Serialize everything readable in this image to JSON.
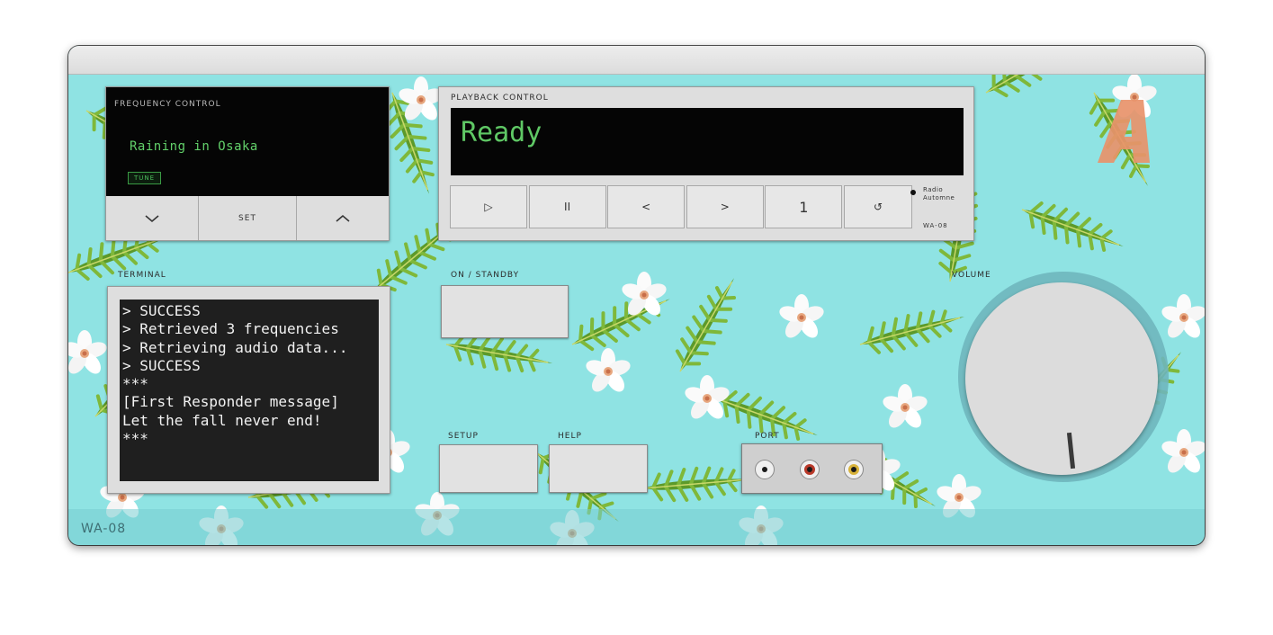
{
  "device": {
    "model_bottom": "WA-08",
    "logo_letter": "A"
  },
  "frequency_control": {
    "label": "FREQUENCY CONTROL",
    "station": "Raining in Osaka",
    "tune_label": "TUNE",
    "down_icon": "chevron-down-icon",
    "set_label": "SET",
    "up_icon": "chevron-up-icon"
  },
  "playback_control": {
    "label": "PLAYBACK CONTROL",
    "status": "Ready",
    "buttons": [
      "▷",
      "II",
      "<",
      ">",
      "1",
      "↺"
    ],
    "brand_line1": "Radio",
    "brand_line2": "Automne",
    "brand_model": "WA-08"
  },
  "terminal": {
    "label": "TERMINAL",
    "lines": [
      "> SUCCESS",
      "> Retrieved 3 frequencies",
      "> Retrieving audio data...",
      "> SUCCESS",
      "***",
      "[First Responder message]",
      "Let the fall never end!",
      "***"
    ]
  },
  "controls": {
    "standby_label": "ON / STANDBY",
    "setup_label": "SETUP",
    "help_label": "HELP",
    "port_label": "PORT",
    "volume_label": "VOLUME"
  },
  "colors": {
    "background": "#8fe3e3",
    "screen_green": "#5fc865",
    "logo_orange": "#e8926a",
    "jack_white": "#f0f0f0",
    "jack_red": "#b93a2a",
    "jack_yellow": "#d8b33a"
  }
}
